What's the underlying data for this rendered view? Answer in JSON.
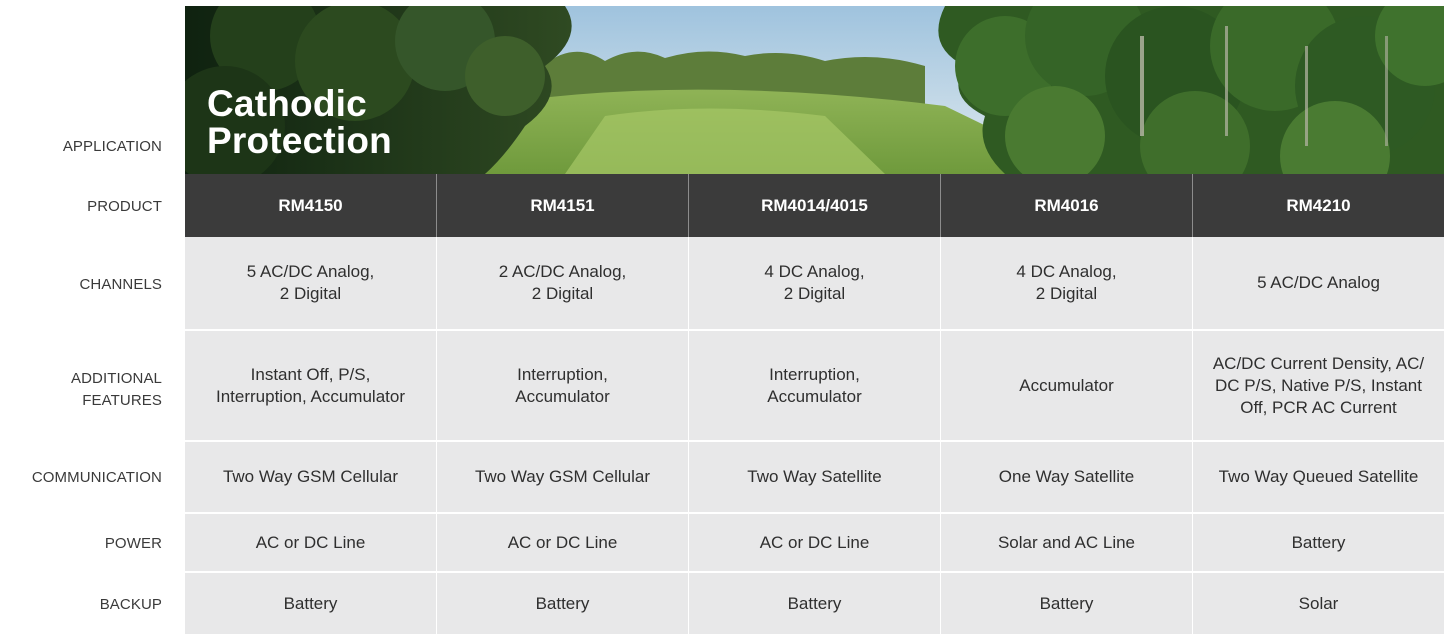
{
  "hero": {
    "title": "Cathodic\nProtection"
  },
  "labels": {
    "application": "APPLICATION",
    "product": "PRODUCT",
    "channels": "CHANNELS",
    "additional_features": "ADDITIONAL\nFEATURES",
    "communication": "COMMUNICATION",
    "power": "POWER",
    "backup": "BACKUP"
  },
  "products": [
    "RM4150",
    "RM4151",
    "RM4014/4015",
    "RM4016",
    "RM4210"
  ],
  "channels": [
    "5 AC/DC Analog,\n2 Digital",
    "2 AC/DC Analog,\n2 Digital",
    "4 DC Analog,\n2 Digital",
    "4 DC Analog,\n2 Digital",
    "5 AC/DC Analog"
  ],
  "additional_features": [
    "Instant Off, P/S,\nInterruption, Accumulator",
    "Interruption,\nAccumulator",
    "Interruption,\nAccumulator",
    "Accumulator",
    "AC/DC Current Density, AC/\nDC P/S, Native P/S, Instant\nOff, PCR AC Current"
  ],
  "communication": [
    "Two Way GSM Cellular",
    "Two Way GSM Cellular",
    "Two Way Satellite",
    "One Way Satellite",
    "Two Way Queued Satellite"
  ],
  "power": [
    "AC or DC Line",
    "AC or DC Line",
    "AC or DC Line",
    "Solar and AC Line",
    "Battery"
  ],
  "backup": [
    "Battery",
    "Battery",
    "Battery",
    "Battery",
    "Solar"
  ],
  "colors": {
    "header_bg": "#3b3b3b",
    "row_bg": "#e8e8e9",
    "label_text": "#3a3a3a"
  }
}
